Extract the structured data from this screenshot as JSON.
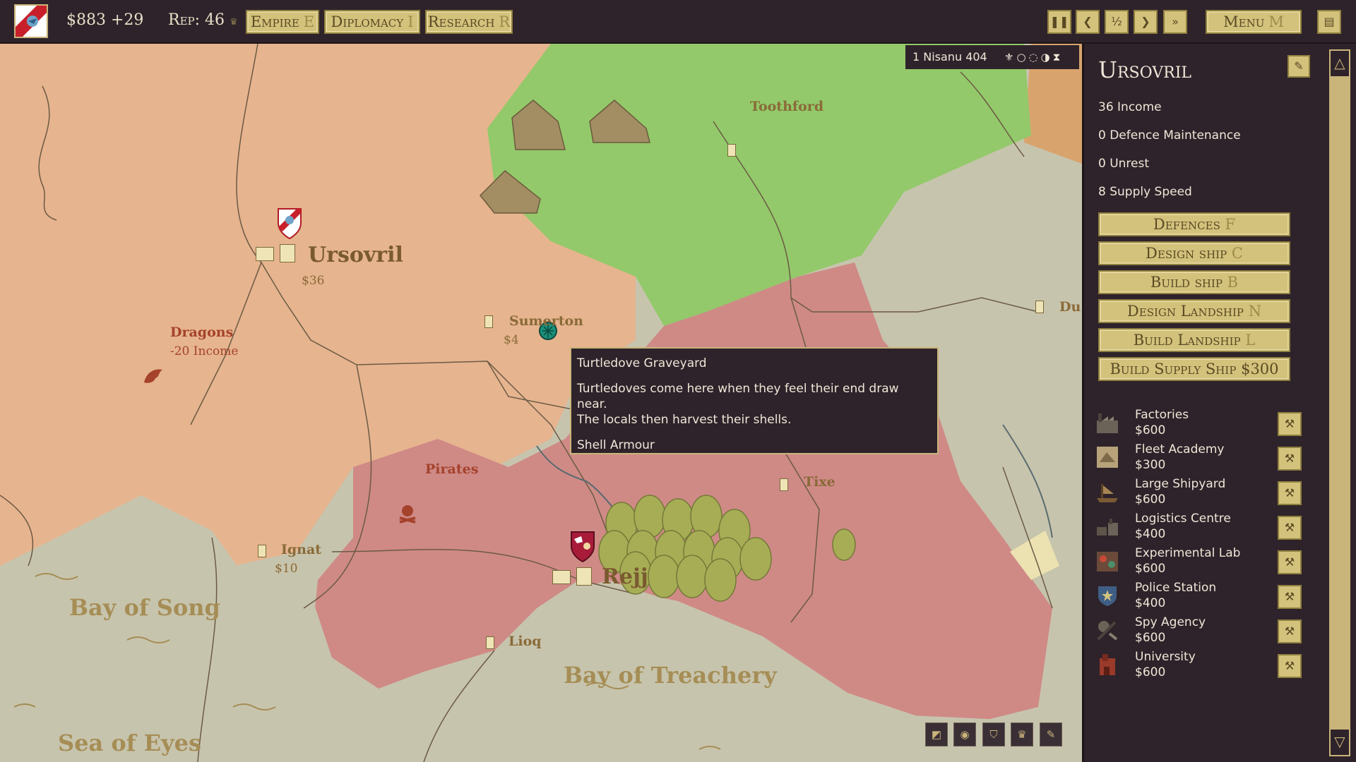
{
  "topbar": {
    "money": "$883 +29",
    "rep": "Rep: 46",
    "buttons": [
      {
        "label": "Empire",
        "key": "E"
      },
      {
        "label": "Diplomacy",
        "key": "I"
      },
      {
        "label": "Research",
        "key": "R"
      }
    ],
    "menu": {
      "label": "Menu",
      "key": "M"
    }
  },
  "date": "1 Nisanu 404",
  "map": {
    "cities": [
      {
        "name": "Ursovril",
        "money": "$36"
      },
      {
        "name": "Sumerton",
        "money": "$4"
      },
      {
        "name": "Toothford"
      },
      {
        "name": "Ignat",
        "money": "$10"
      },
      {
        "name": "Rejj"
      },
      {
        "name": "Tixe"
      },
      {
        "name": "Lioq"
      },
      {
        "name": "Du"
      }
    ],
    "features": [
      {
        "name": "Dragons",
        "detail": "-20 Income"
      },
      {
        "name": "Pirates"
      }
    ],
    "seas": [
      "Bay of Song",
      "Bay of Treachery",
      "Sea of Eyes"
    ]
  },
  "tooltip": {
    "title": "Turtledove Graveyard",
    "line1": "Turtledoves come here when they feel their end draw near.",
    "line2": "The locals then harvest their shells.",
    "effect": "Shell Armour"
  },
  "panel": {
    "title": "Ursovril",
    "stats": [
      "36 Income",
      "0 Defence Maintenance",
      "0 Unrest",
      "8 Supply Speed"
    ],
    "actions": [
      {
        "label": "Defences",
        "key": "F"
      },
      {
        "label": "Design ship",
        "key": "C"
      },
      {
        "label": "Build ship",
        "key": "B"
      },
      {
        "label": "Design Landship",
        "key": "N"
      },
      {
        "label": "Build Landship",
        "key": "L"
      },
      {
        "label": "Build Supply Ship $300",
        "key": ""
      }
    ],
    "buildings": [
      {
        "name": "Factories",
        "cost": "$600",
        "icon": "factory-icon"
      },
      {
        "name": "Fleet Academy",
        "cost": "$300",
        "icon": "academy-icon"
      },
      {
        "name": "Large Shipyard",
        "cost": "$600",
        "icon": "shipyard-icon"
      },
      {
        "name": "Logistics Centre",
        "cost": "$400",
        "icon": "logistics-icon"
      },
      {
        "name": "Experimental Lab",
        "cost": "$600",
        "icon": "lab-icon"
      },
      {
        "name": "Police Station",
        "cost": "$400",
        "icon": "police-icon"
      },
      {
        "name": "Spy Agency",
        "cost": "$600",
        "icon": "spy-icon"
      },
      {
        "name": "University",
        "cost": "$600",
        "icon": "university-icon"
      }
    ]
  },
  "colors": {
    "player_territory": "#e6b48e",
    "green_nation": "#93c96a",
    "red_nation": "#cf8a86",
    "sea": "#c7c4ad",
    "ui_dark": "#2e232a",
    "button": "#d3c27c"
  }
}
